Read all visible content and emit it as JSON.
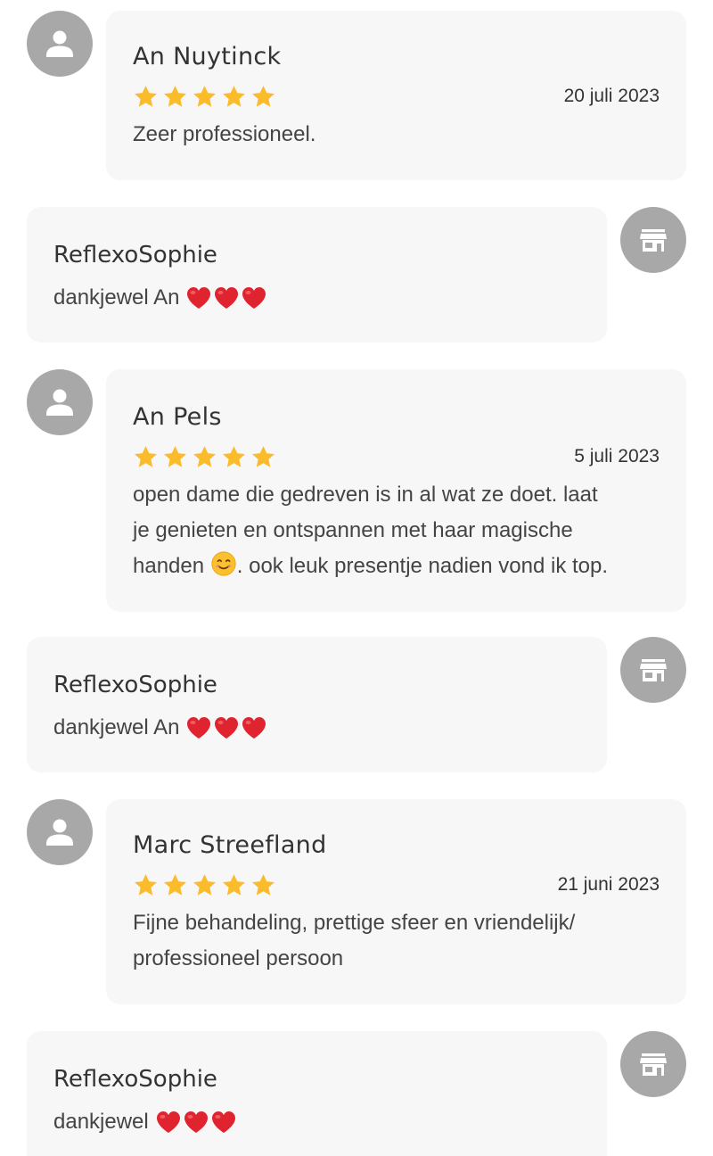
{
  "reviews": [
    {
      "author": "An Nuytinck",
      "rating": 5,
      "date": "20 juli 2023",
      "text": "Zeer professioneel.",
      "reply": {
        "author": "ReflexoSophie",
        "text": "dankjewel An",
        "hearts": 3
      }
    },
    {
      "author": "An Pels",
      "rating": 5,
      "date": "5 juli 2023",
      "text_lines": [
        "open dame die gedreven is in al wat ze doet. laat",
        "je genieten en ontspannen met haar magische",
        "handen",
        ". ook leuk presentje nadien vond ik top."
      ],
      "reply": {
        "author": "ReflexoSophie",
        "text": "dankjewel An",
        "hearts": 3
      }
    },
    {
      "author": "Marc Streefland",
      "rating": 5,
      "date": "21 juni 2023",
      "text_lines": [
        "Fijne behandeling, prettige sfeer en vriendelijk/",
        "professioneel persoon"
      ],
      "reply": {
        "author": "ReflexoSophie",
        "text": "dankjewel",
        "hearts": 3
      }
    }
  ],
  "icons": {
    "user_avatar": "person-icon",
    "shop_avatar": "store-icon",
    "star": "star-icon",
    "heart": "heart-icon",
    "smile": "smiling-face-icon"
  },
  "colors": {
    "avatar_bg": "#a8a8a8",
    "card_bg": "#f7f7f7",
    "star": "#fbbc2c",
    "heart": "#e0242f"
  }
}
